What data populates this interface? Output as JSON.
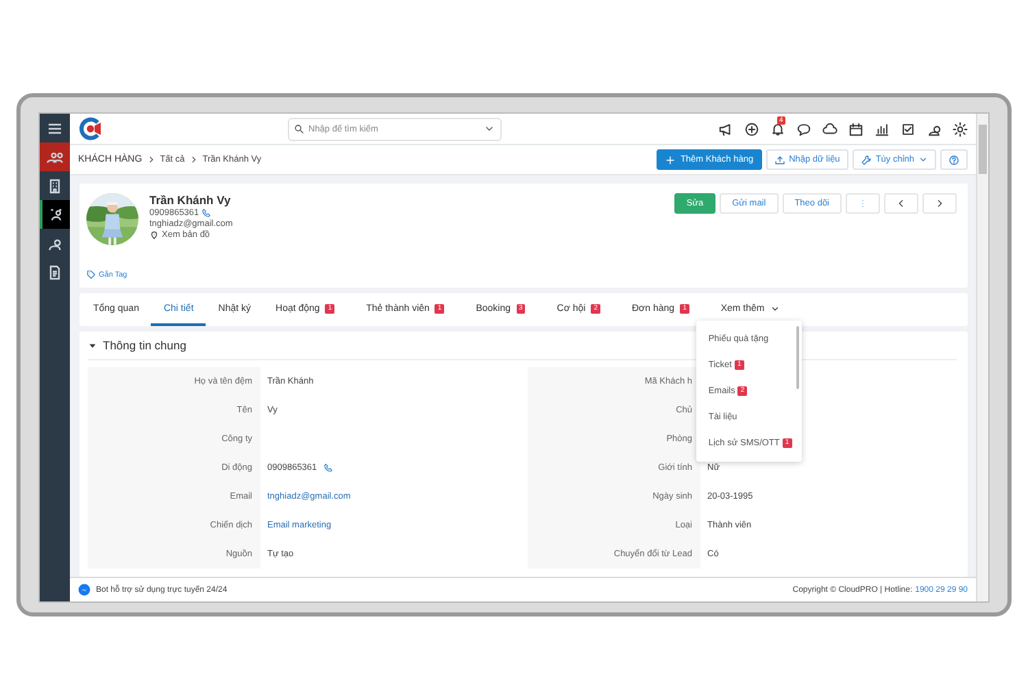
{
  "sidebar": {
    "items": [
      {
        "kind": "menu",
        "selected": false
      },
      {
        "kind": "people",
        "selected": false,
        "color": "#b3261e"
      },
      {
        "kind": "building",
        "selected": false
      },
      {
        "kind": "contacts",
        "selected": true
      },
      {
        "kind": "person",
        "selected": false
      },
      {
        "kind": "document",
        "selected": false
      }
    ]
  },
  "top_bar": {
    "search": {
      "placeholder": "Nhập để tìm kiếm"
    },
    "icons": [
      {
        "kind": "megaphone"
      },
      {
        "kind": "plus-circle"
      },
      {
        "kind": "bell",
        "badge": "4"
      },
      {
        "kind": "chat"
      },
      {
        "kind": "cloud"
      },
      {
        "kind": "calendar"
      },
      {
        "kind": "chart"
      },
      {
        "kind": "checkbox"
      },
      {
        "kind": "user"
      },
      {
        "kind": "gear"
      }
    ]
  },
  "breadcrumb": [
    "KHÁCH HÀNG",
    "Tất cả",
    "Trần Khánh Vy"
  ],
  "toolbar": {
    "buttons": [
      {
        "kind": "primary",
        "label": "Thêm Khách hàng"
      },
      {
        "kind": "plain",
        "label": "Nhập dữ liệu"
      },
      {
        "kind": "dropdown",
        "label": "Tùy chỉnh"
      },
      {
        "kind": "help"
      }
    ]
  },
  "profile": {
    "name": "Trần Khánh Vy",
    "phone": "0909865361",
    "email": "tnghiadz@gmail.com",
    "map_link": "Xem bản đồ",
    "tag_link": "Gắn Tag",
    "actions": [
      {
        "kind": "success",
        "label": "Sửa"
      },
      {
        "kind": "plain",
        "label": "Gửi mail"
      },
      {
        "kind": "plain",
        "label": "Theo dõi"
      },
      {
        "kind": "more"
      },
      {
        "kind": "prev"
      },
      {
        "kind": "next"
      }
    ]
  },
  "tabs": [
    {
      "label": "Tổng quan",
      "selected": false
    },
    {
      "label": "Chi tiết",
      "selected": true
    },
    {
      "label": "Nhật ký",
      "selected": false
    },
    {
      "label": "Hoạt động",
      "badge": "1",
      "selected": false
    },
    {
      "label": "Thẻ thành viên",
      "badge": "1",
      "selected": false
    },
    {
      "label": "Booking",
      "badge": "3",
      "selected": false
    },
    {
      "label": "Cơ hội",
      "badge": "2",
      "selected": false
    },
    {
      "label": "Đơn hàng",
      "badge": "1",
      "selected": false
    }
  ],
  "more_menu": {
    "label": "Xem thêm",
    "expanded": true,
    "items": [
      {
        "label": "Phiếu quà tặng"
      },
      {
        "label": "Ticket",
        "badge": "1"
      },
      {
        "label": "Emails",
        "badge": "2"
      },
      {
        "label": "Tài liệu"
      },
      {
        "label": "Lịch sử SMS/OTT",
        "badge": "1"
      }
    ]
  },
  "section": {
    "title": "Thông tin chung",
    "expanded": true,
    "left": [
      {
        "label": "Họ và tên đệm",
        "value": "Trần Khánh"
      },
      {
        "label": "Tên",
        "value": "Vy"
      },
      {
        "label": "Công ty"
      },
      {
        "label": "Di động",
        "value": "0909865361",
        "kind": "phone"
      },
      {
        "label": "Email",
        "value": "tnghiadz@gmail.com",
        "kind": "link"
      },
      {
        "label": "Chiến dịch",
        "value": "Email marketing",
        "kind": "link"
      },
      {
        "label": "Nguồn",
        "value": "Tự tạo"
      }
    ],
    "right": [
      {
        "label": "Mã Khách h"
      },
      {
        "label": "Chủ"
      },
      {
        "label": "Phòng"
      },
      {
        "label": "Giới tính",
        "value": "Nữ"
      },
      {
        "label": "Ngày sinh",
        "value": "20-03-1995"
      },
      {
        "label": "Loại",
        "value": "Thành viên"
      },
      {
        "label": "Chuyển đổi từ Lead",
        "value": "Có"
      }
    ]
  },
  "footer": {
    "bot_text": "Bot hỗ trợ sử dụng trực tuyến 24/24",
    "copyright": "Copyright © CloudPRO | Hotline:",
    "hotline": "1900 29 29 90"
  }
}
